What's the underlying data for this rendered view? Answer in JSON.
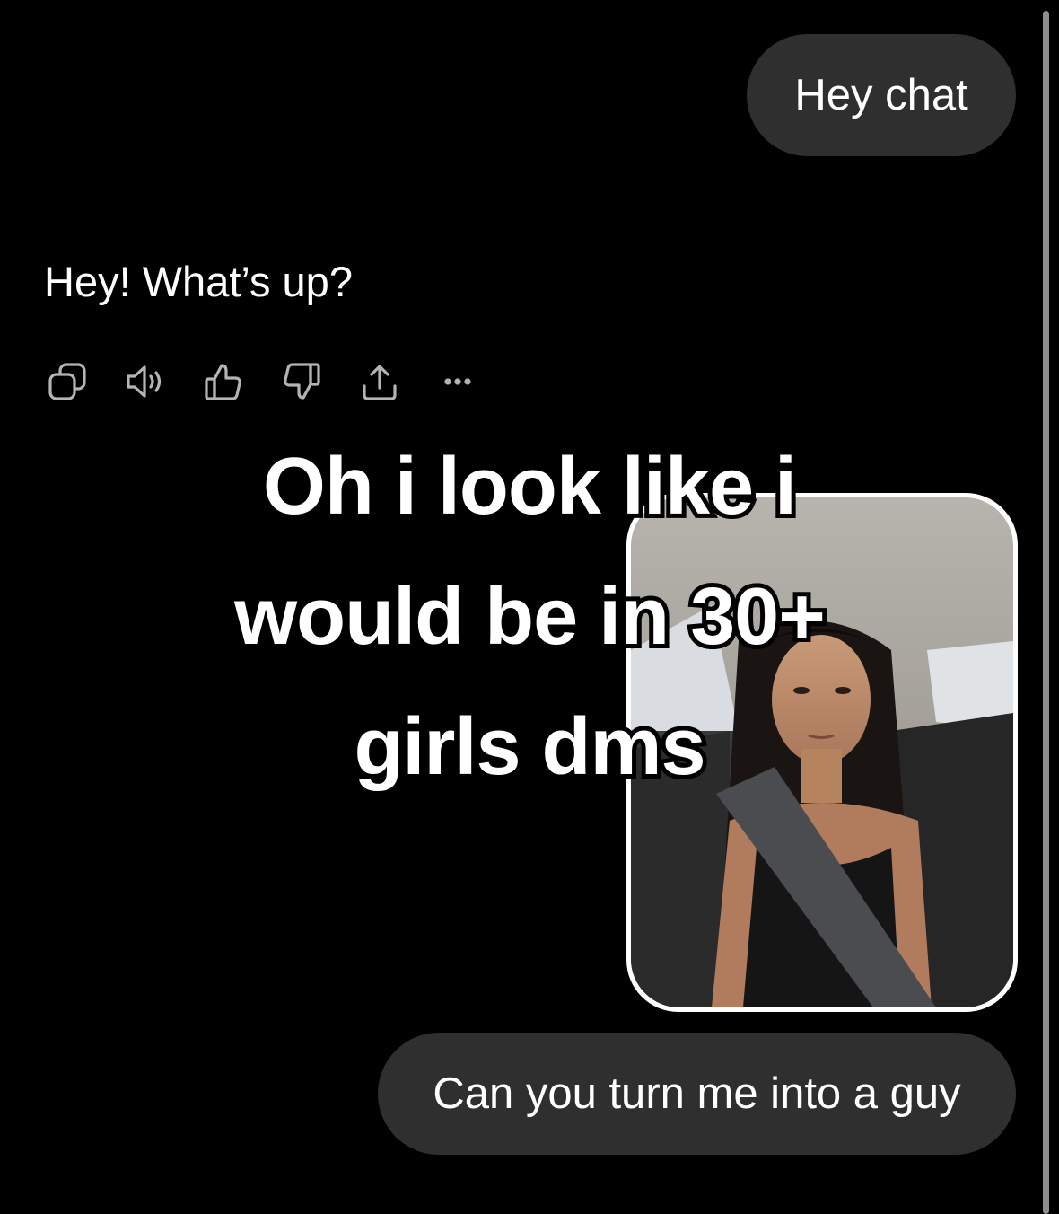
{
  "conversation": {
    "user_message_1": "Hey chat",
    "assistant_message_1": "Hey! What’s up?",
    "user_message_2": "Can you turn me into a guy"
  },
  "message_actions": [
    {
      "name": "copy-icon"
    },
    {
      "name": "read-aloud-icon"
    },
    {
      "name": "thumbs-up-icon"
    },
    {
      "name": "thumbs-down-icon"
    },
    {
      "name": "share-icon"
    },
    {
      "name": "more-icon"
    }
  ],
  "overlay_caption": {
    "line1": "Oh i look like i",
    "line2": "would be in 30+",
    "line3": "girls dms"
  },
  "colors": {
    "background": "#000000",
    "user_bubble": "#2f2f2f",
    "text": "#ffffff",
    "icon": "#b4b4b4"
  }
}
